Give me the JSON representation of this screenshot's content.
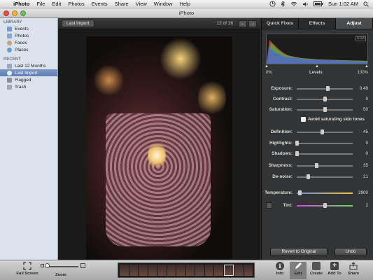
{
  "menubar": {
    "app_name": "iPhoto",
    "items": [
      "File",
      "Edit",
      "Photos",
      "Events",
      "Share",
      "View",
      "Window",
      "Help"
    ],
    "clock": "Sun 1:02 AM"
  },
  "window": {
    "title": "iPhoto"
  },
  "sidebar": {
    "library_header": "LIBRARY",
    "library_items": [
      "Events",
      "Photos",
      "Faces",
      "Places"
    ],
    "recent_header": "RECENT",
    "recent_items": [
      "Last 12 Months",
      "Last Import",
      "Flagged",
      "Trash"
    ],
    "selected": "Last Import"
  },
  "viewer": {
    "album_button": "Last Import",
    "counter": "12 of 16",
    "prev_glyph": "←",
    "next_glyph": "→"
  },
  "panel": {
    "tabs": [
      "Quick Fixes",
      "Effects",
      "Adjust"
    ],
    "active_tab": "Adjust",
    "levels": {
      "min": "0%",
      "label": "Levels",
      "max": "100%"
    },
    "histogram_badge": "RGB",
    "sliders": [
      {
        "label": "Exposure:",
        "value": "0.48",
        "fraction": 0.55
      },
      {
        "label": "Contrast:",
        "value": "0",
        "fraction": 0.5
      },
      {
        "label": "Saturation:",
        "value": "50",
        "fraction": 0.5
      },
      {
        "label": "Definition:",
        "value": "45",
        "fraction": 0.45
      },
      {
        "label": "Highlights:",
        "value": "0",
        "fraction": 0.0
      },
      {
        "label": "Shadows:",
        "value": "0",
        "fraction": 0.0
      },
      {
        "label": "Sharpness:",
        "value": "35",
        "fraction": 0.35
      },
      {
        "label": "De-noise:",
        "value": "21",
        "fraction": 0.21
      },
      {
        "label": "Temperature:",
        "value": "2900",
        "fraction": 0.05
      },
      {
        "label": "Tint:",
        "value": "2",
        "fraction": 0.51
      }
    ],
    "checkbox_label": "Avoid saturating skin tones",
    "revert_button": "Revert to Original",
    "undo_button": "Undo"
  },
  "bottombar": {
    "full_screen": "Full Screen",
    "zoom": "Zoom",
    "buttons": [
      "Info",
      "Edit",
      "Create",
      "Add To",
      "Share"
    ],
    "active_button": "Edit"
  },
  "colors": {
    "selection": "#5e7fb6",
    "panel_bg": "#333435",
    "temperature_gradient": [
      "#6b8fd8",
      "#f0c040"
    ],
    "tint_gradient": [
      "#e040e0",
      "#60e060"
    ]
  }
}
